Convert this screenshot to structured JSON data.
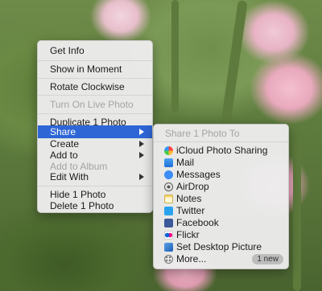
{
  "main_menu": {
    "items": [
      {
        "label": "Get Info",
        "state": "normal"
      },
      {
        "label": "Show in Moment",
        "state": "normal"
      },
      {
        "label": "Rotate Clockwise",
        "state": "normal"
      },
      {
        "label": "Turn On Live Photo",
        "state": "disabled"
      },
      {
        "label": "Duplicate 1 Photo",
        "state": "normal"
      },
      {
        "label": "Share",
        "state": "active",
        "submenu": true
      },
      {
        "label": "Create",
        "state": "normal",
        "submenu": true
      },
      {
        "label": "Add to",
        "state": "normal",
        "submenu": true
      },
      {
        "label": "Add to Album",
        "state": "disabled"
      },
      {
        "label": "Edit With",
        "state": "normal",
        "submenu": true
      },
      {
        "label": "Hide 1 Photo",
        "state": "normal"
      },
      {
        "label": "Delete 1 Photo",
        "state": "normal"
      }
    ]
  },
  "share_submenu": {
    "header": "Share 1 Photo To",
    "items": [
      {
        "label": "iCloud Photo Sharing",
        "icon": "icloud-photo-sharing-icon"
      },
      {
        "label": "Mail",
        "icon": "mail-icon"
      },
      {
        "label": "Messages",
        "icon": "messages-icon"
      },
      {
        "label": "AirDrop",
        "icon": "airdrop-icon"
      },
      {
        "label": "Notes",
        "icon": "notes-icon"
      },
      {
        "label": "Twitter",
        "icon": "twitter-icon"
      },
      {
        "label": "Facebook",
        "icon": "facebook-icon"
      },
      {
        "label": "Flickr",
        "icon": "flickr-icon"
      },
      {
        "label": "Set Desktop Picture",
        "icon": "desktop-picture-icon"
      },
      {
        "label": "More...",
        "icon": "more-icon",
        "badge": "1 new"
      }
    ]
  },
  "colors": {
    "highlight": "#2e66d6",
    "menu_bg": "#ececec",
    "disabled_text": "#a3a3a3"
  }
}
